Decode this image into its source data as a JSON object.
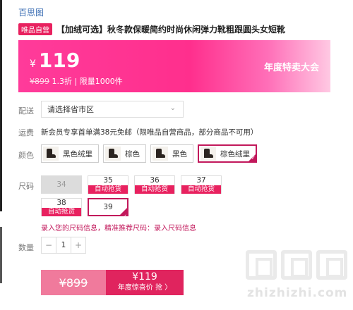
{
  "brand": "百思图",
  "title_tag": "唯品自营",
  "title": "【加绒可选】秋冬款保暖简约时尚休闲弹力靴粗跟圆头女短靴",
  "banner": {
    "currency": "¥",
    "price": "119",
    "original_price": "¥899",
    "discount": "1.3折 | 限量1000件",
    "event": "年度特卖大会"
  },
  "delivery": {
    "label": "配送",
    "placeholder": "请选择省市区",
    "chevron_icon": "chevron-down-icon"
  },
  "shipping": {
    "label": "运费",
    "text": "新会员专享首单满38元免邮（限唯品自营商品，部分商品不可用）"
  },
  "colors": {
    "label": "颜色",
    "options": [
      "黑色绒里",
      "棕色",
      "黑色",
      "棕色绒里"
    ],
    "selected": "棕色绒里"
  },
  "sizes": {
    "label": "尺码",
    "options": [
      {
        "size": "34",
        "state": "disabled"
      },
      {
        "size": "35",
        "badge": "自动抢货"
      },
      {
        "size": "36",
        "badge": "自动抢货"
      },
      {
        "size": "37",
        "badge": "自动抢货"
      },
      {
        "size": "38",
        "badge": "自动抢货"
      },
      {
        "size": "39",
        "state": "selected"
      }
    ],
    "hint": "录入您的尺码信息，精准推荐尺码：录入尺码信息"
  },
  "quantity": {
    "label": "数量",
    "minus": "−",
    "value": "1",
    "plus": "+"
  },
  "buy": {
    "old_price": "¥899",
    "price": "¥119",
    "action": "年度惊喜价 抢 〉"
  },
  "watermark": "zhizhizhi.com",
  "colors_hex": {
    "accent": "#e8215f",
    "selected_border": "#c2185b",
    "banner": "#ff2f8d"
  }
}
